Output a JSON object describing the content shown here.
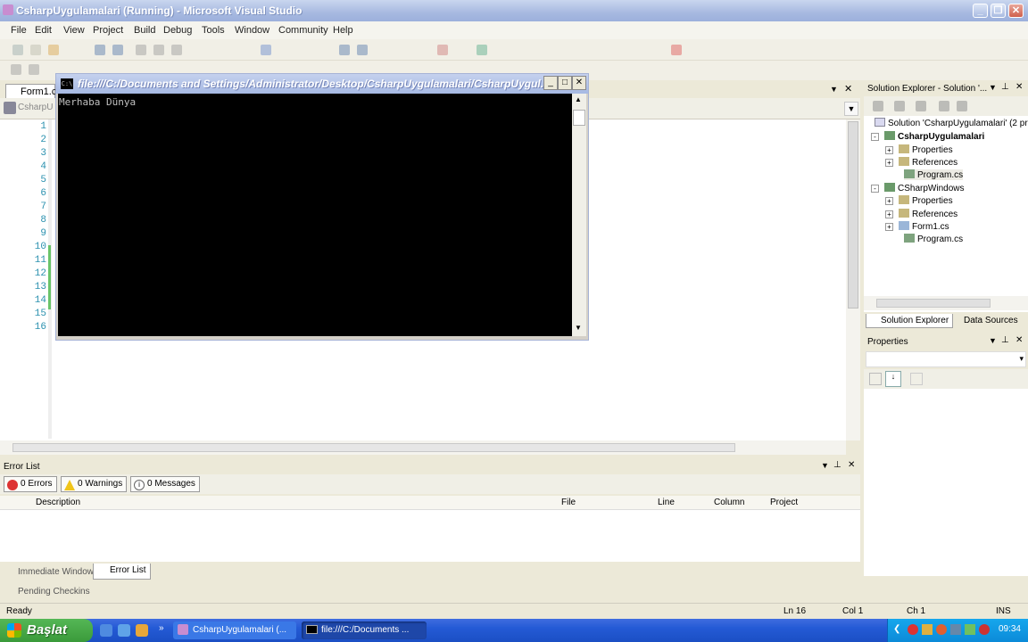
{
  "window": {
    "title": "CsharpUygulamalari (Running) - Microsoft Visual Studio"
  },
  "menu": [
    "File",
    "Edit",
    "View",
    "Project",
    "Build",
    "Debug",
    "Tools",
    "Window",
    "Community",
    "Help"
  ],
  "editor": {
    "doc_tab": "Form1.cs",
    "combo_left": "CsharpU",
    "line_numbers": [
      "1",
      "2",
      "3",
      "4",
      "5",
      "6",
      "7",
      "8",
      "9",
      "10",
      "11",
      "12",
      "13",
      "14",
      "15",
      "16"
    ]
  },
  "console": {
    "title": "file:///C:/Documents and Settings/Administrator/Desktop/CsharpUygulamalari/CsharpUygul...",
    "icon_text": "C:\\",
    "output": "Merhaba Dünya"
  },
  "solution_explorer": {
    "title": "Solution Explorer - Solution '...",
    "tree": [
      {
        "label": "Solution 'CsharpUygulamalari' (2 pro",
        "indent": 0,
        "icon": "solution-icon"
      },
      {
        "label": "CsharpUygulamalari",
        "indent": 1,
        "bold": true,
        "icon": "project-icon",
        "expander": "-"
      },
      {
        "label": "Properties",
        "indent": 2,
        "icon": "properties-folder-icon",
        "expander": "+"
      },
      {
        "label": "References",
        "indent": 2,
        "icon": "references-folder-icon",
        "expander": "+"
      },
      {
        "label": "Program.cs",
        "indent": 2,
        "icon": "cs-file-icon",
        "selected": true
      },
      {
        "label": "CSharpWindows",
        "indent": 1,
        "icon": "project-icon",
        "expander": "-"
      },
      {
        "label": "Properties",
        "indent": 2,
        "icon": "properties-folder-icon",
        "expander": "+"
      },
      {
        "label": "References",
        "indent": 2,
        "icon": "references-folder-icon",
        "expander": "+"
      },
      {
        "label": "Form1.cs",
        "indent": 2,
        "icon": "form-file-icon",
        "expander": "+"
      },
      {
        "label": "Program.cs",
        "indent": 2,
        "icon": "cs-file-icon"
      }
    ],
    "tabs": [
      "Solution Explorer",
      "Data Sources"
    ]
  },
  "properties": {
    "title": "Properties"
  },
  "error_list": {
    "title": "Error List",
    "filters": [
      "0 Errors",
      "0 Warnings",
      "0 Messages"
    ],
    "columns": [
      "Description",
      "File",
      "Line",
      "Column",
      "Project"
    ]
  },
  "bottom_tabs": [
    "Immediate Window",
    "Error List",
    "Pending Checkins"
  ],
  "status": {
    "text": "Ready",
    "ln": "Ln 16",
    "col": "Col 1",
    "ch": "Ch 1",
    "mode": "INS"
  },
  "taskbar": {
    "start": "Başlat",
    "tasks": [
      "CsharpUygulamalari (...",
      "file:///C:/Documents ..."
    ],
    "clock": "09:34"
  },
  "colors": {
    "console_bg": "#000000",
    "console_text": "#c0c0c0",
    "taskbar": "#245ad5",
    "start": "#3a9a3a",
    "title_gradient": "#a7b9e0"
  }
}
